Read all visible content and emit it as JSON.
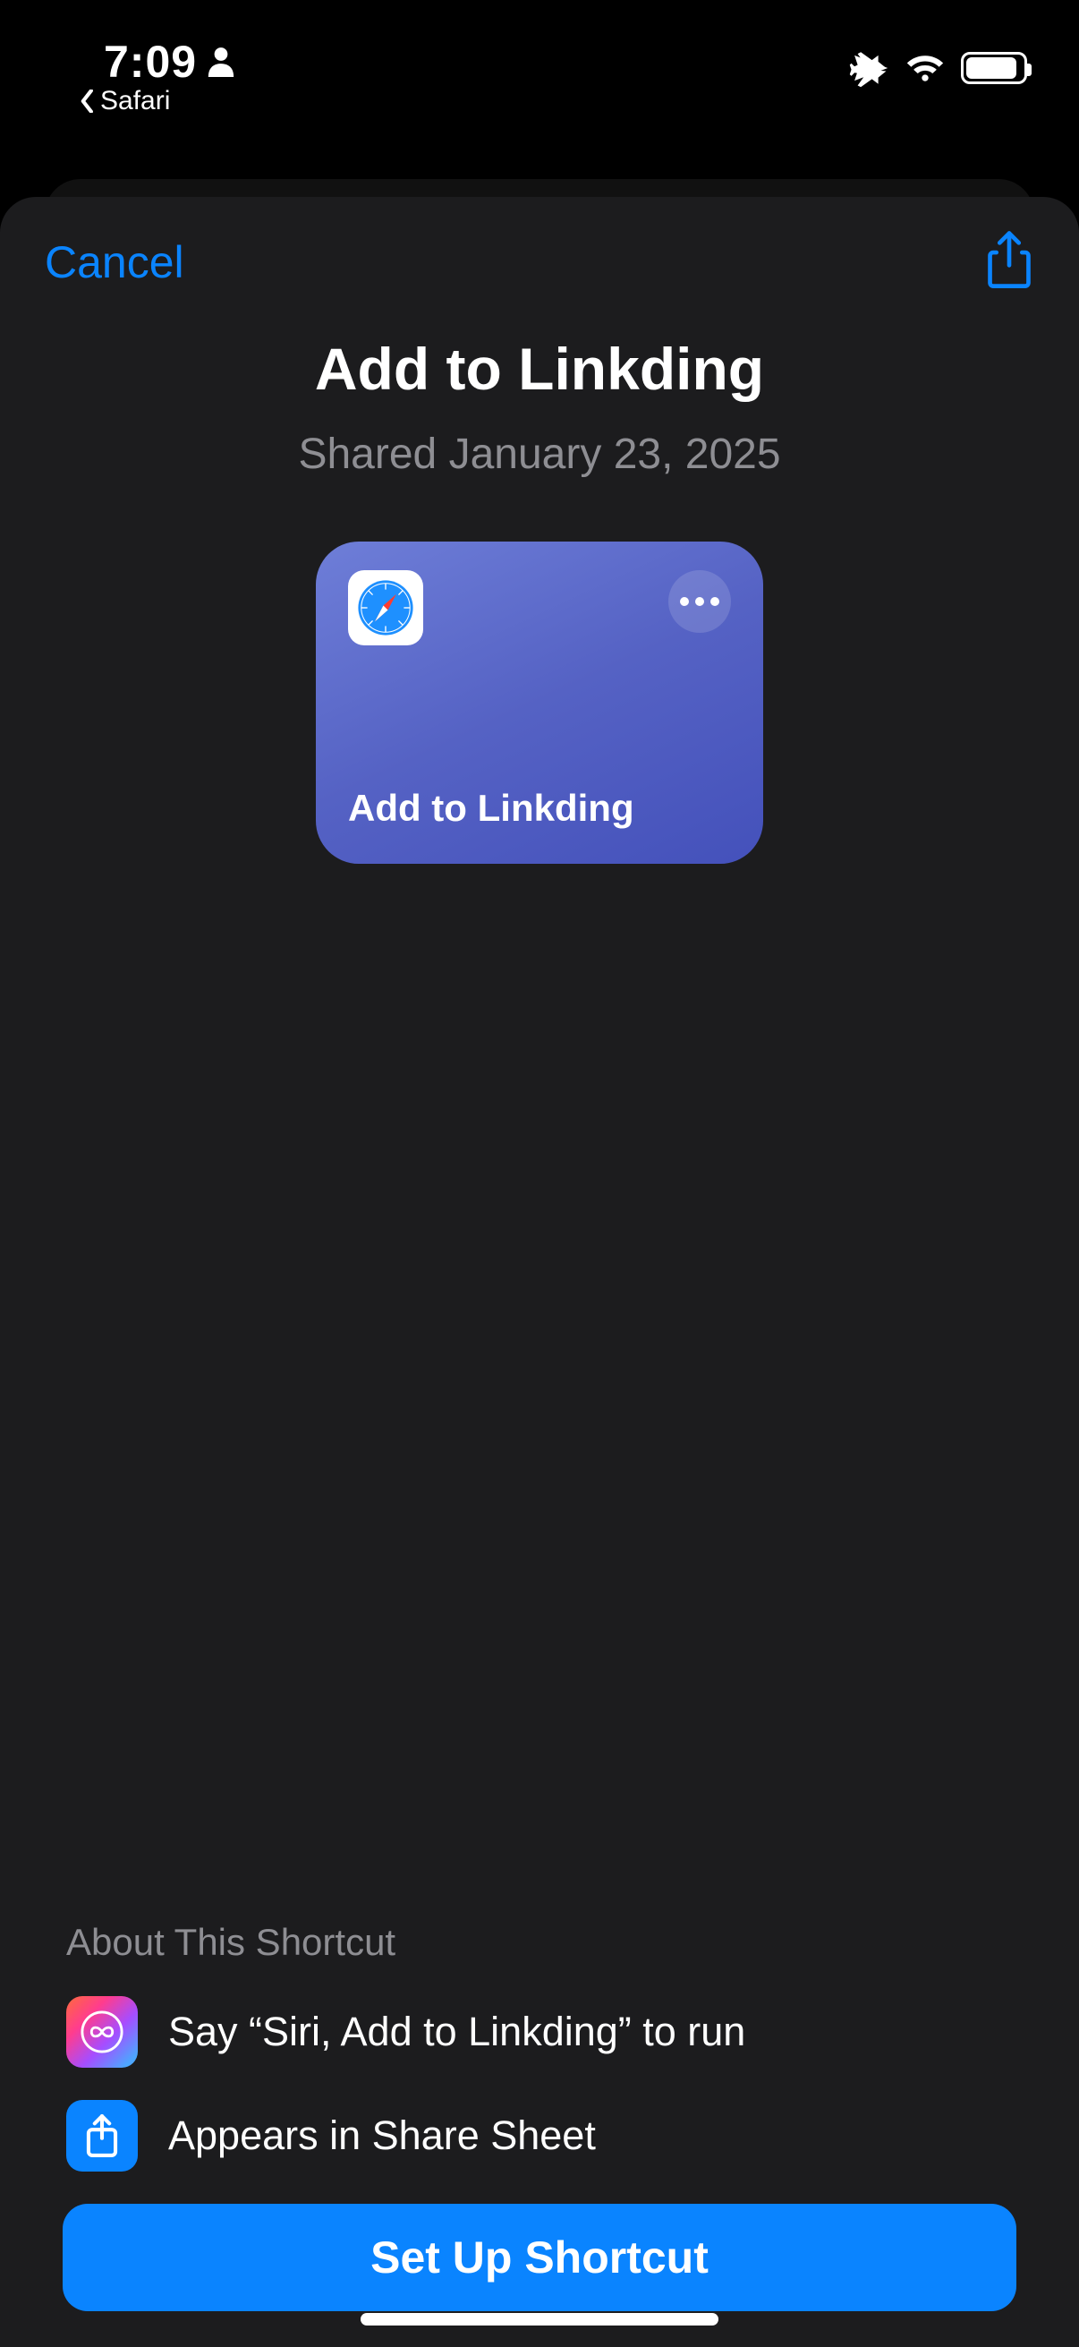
{
  "statusbar": {
    "time": "7:09",
    "back_app": "Safari"
  },
  "sheet": {
    "cancel_label": "Cancel",
    "title": "Add to Linkding",
    "subtitle": "Shared January 23, 2025"
  },
  "tile": {
    "label": "Add to Linkding"
  },
  "about": {
    "heading": "About This Shortcut",
    "siri_text": "Say “Siri, Add to Linkding” to run",
    "sharesheet_text": "Appears in Share Sheet"
  },
  "primary_button": {
    "label": "Set Up Shortcut"
  }
}
